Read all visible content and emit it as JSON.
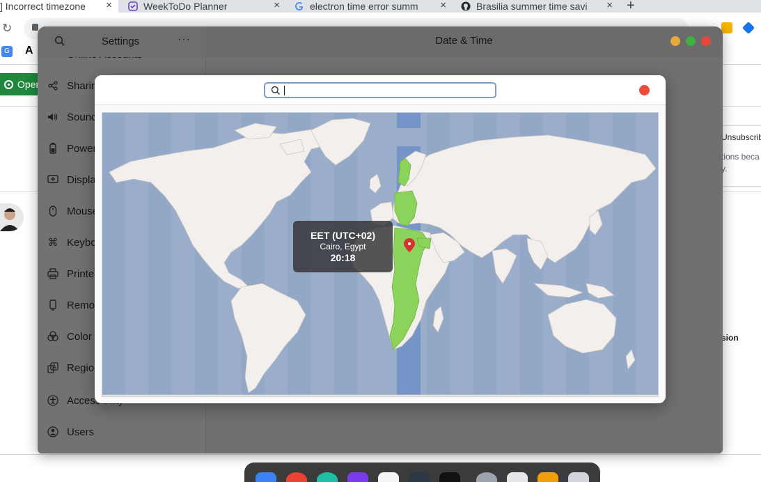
{
  "browser": {
    "tabs": [
      {
        "title": "] Incorrect timezone",
        "active": true
      },
      {
        "title": "WeekToDo Planner",
        "active": false
      },
      {
        "title": "electron time error summ",
        "active": false
      },
      {
        "title": "Brasilia summer time savi",
        "active": false
      }
    ],
    "tab_close_glyph": "×",
    "new_tab_glyph": "+",
    "open_button": "Oper",
    "unsubscribe": "Unsubscrib",
    "notif_line1": "tions beca",
    "notif_line2": "y.",
    "side_bold": "sion"
  },
  "settings": {
    "sidebar_title": "Settings",
    "menu_glyph": "···",
    "window_title": "Date & Time",
    "items": [
      {
        "label": "Online Accounts",
        "icon": "online-accounts-icon"
      },
      {
        "label": "Sharing",
        "icon": "sharing-icon"
      },
      {
        "label": "Sound",
        "icon": "sound-icon"
      },
      {
        "label": "Power",
        "icon": "power-icon"
      },
      {
        "label": "Displays",
        "icon": "displays-icon"
      },
      {
        "label": "Mouse",
        "icon": "mouse-icon"
      },
      {
        "label": "Keyboard",
        "icon": "keyboard-icon"
      },
      {
        "label": "Printers",
        "icon": "printers-icon"
      },
      {
        "label": "Removable",
        "icon": "removable-media-icon"
      },
      {
        "label": "Color",
        "icon": "color-icon"
      },
      {
        "label": "Region",
        "icon": "region-icon"
      },
      {
        "label": "Accessibility",
        "icon": "accessibility-icon"
      },
      {
        "label": "Users",
        "icon": "users-icon"
      }
    ],
    "window_buttons": {
      "minimize": "#e2ab3b",
      "maximize": "#3fb13e",
      "close": "#e2483c"
    }
  },
  "timezone_dialog": {
    "search_value": "",
    "selected_zone": "EET (UTC+02)",
    "selected_city": "Cairo, Egypt",
    "selected_time": "20:18",
    "close_color": "#ed4b3c",
    "map_colors": {
      "ocean": "#9aaecb",
      "land": "#f2efec",
      "highlight": "#8bd35a",
      "band": "#7595c9",
      "pin": "#d9302f"
    }
  }
}
